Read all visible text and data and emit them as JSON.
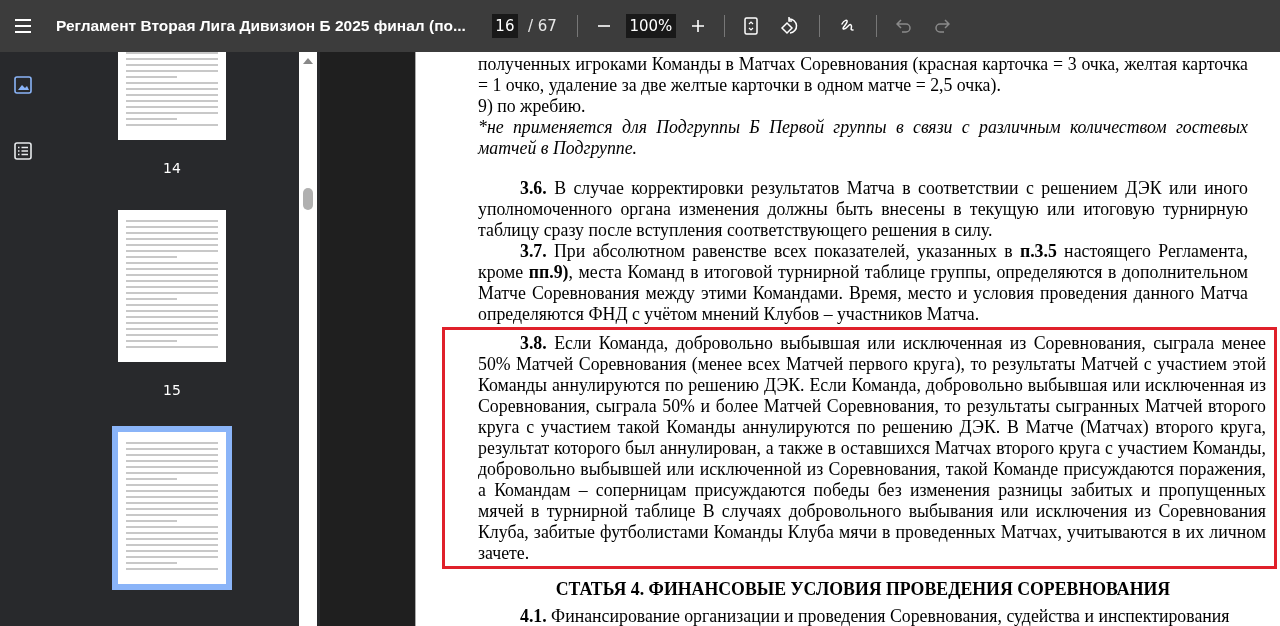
{
  "toolbar": {
    "title": "Регламент Вторая Лига Дивизион Б 2025 финал (по...",
    "page_current": "16",
    "page_total": "/ 67",
    "zoom": "100%",
    "undo_disabled": true,
    "redo_disabled": true
  },
  "sidebar": {
    "tabs": [
      {
        "kind": "thumbnails",
        "selected": true
      },
      {
        "kind": "outline",
        "selected": false
      }
    ],
    "thumbnails": [
      {
        "label": "14",
        "selected": false
      },
      {
        "label": "15",
        "selected": false
      },
      {
        "selected": true
      }
    ]
  },
  "document": {
    "blocks": [
      {
        "kind": "continuation",
        "text": "полученных игроками Команды в Матчах Соревнования (красная карточка = 3 очка, желтая карточка = 1 очко, удаление за две желтые карточки в одном матче = 2,5 очка).",
        "highlighted": false
      },
      {
        "kind": "item",
        "text": "9) по жребию.",
        "highlighted": false
      },
      {
        "kind": "note",
        "text": "*не применяется для Подгруппы Б Первой группы в связи с различным количеством гостевых матчей в Подгруппе.",
        "highlighted": false
      },
      {
        "kind": "clause",
        "text": "**3.6.** В случае корректировки результатов Матча в соответствии с решением ДЭК или иного уполномоченного органа изменения должны быть внесены в текущую или итоговую турнирную таблицу сразу после вступления соответствующего решения в силу.",
        "highlighted": false
      },
      {
        "kind": "clause",
        "text": "**3.7.** При абсолютном равенстве всех показателей, указанных в **п.3.5** настоящего Регламента, кроме **пп.9)**, места Команд в итоговой турнирной таблице группы, определяются в дополнительном Матче Соревнования между этими Командами. Время, место и условия проведения данного Матча определяются ФНД с учётом мнений Клубов – участников Матча.",
        "highlighted": false
      },
      {
        "kind": "clause",
        "text": "**3.8.** Если Команда, добровольно выбывшая или исключенная из Соревнования, сыграла менее 50% Матчей Соревнования (менее всех Матчей первого круга), то результаты Матчей с участием этой Команды аннулируются по решению ДЭК. Если Команда, добровольно выбывшая или исключенная из Соревнования, сыграла 50% и более Матчей Соревнования, то результаты сыгранных Матчей второго круга с участием такой Команды аннулируются по решению ДЭК. В Матче (Матчах) второго круга, результат которого был аннулирован, а также в оставшихся Матчах второго круга с участием Команды, добровольно выбывшей или исключенной из Соревнования, такой Команде присуждаются поражения, а Командам – соперницам присуждаются победы без изменения разницы забитых и пропущенных мячей в турнирной таблице В случаях добровольного выбывания или исключения из Соревнования Клуба, забитые футболистами Команды Клуба мячи в проведенных Матчах, учитываются в их личном зачете.",
        "highlighted": true
      },
      {
        "kind": "heading",
        "text": "СТАТЬЯ 4. ФИНАНСОВЫЕ УСЛОВИЯ ПРОВЕДЕНИЯ СОРЕВНОВАНИЯ",
        "highlighted": false
      },
      {
        "kind": "clause",
        "text": "**4.1.** Финансирование организации и проведения Соревнования, судейства и инспектирования",
        "highlighted": false
      }
    ]
  }
}
